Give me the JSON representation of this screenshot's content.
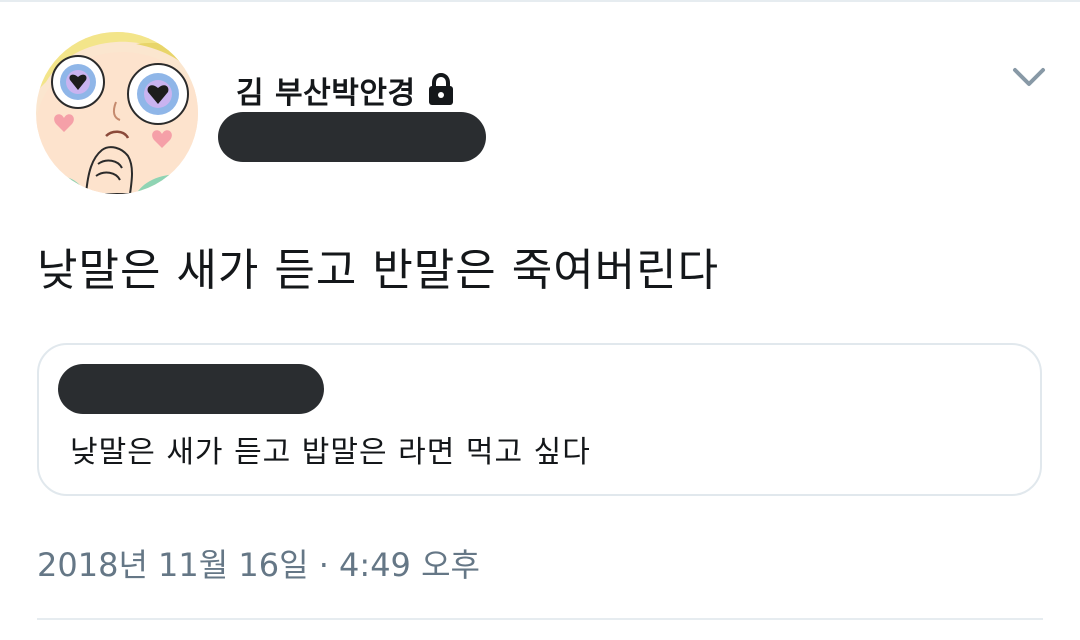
{
  "tweet": {
    "author": {
      "display_name": "김 부산박안경",
      "protected_icon": "lock-icon",
      "avatar_icon": "cartoon-avatar"
    },
    "menu_icon": "chevron-down-icon",
    "text": "낮말은 새가 듣고 반말은 죽여버린다",
    "quoted_tweet": {
      "text": "낮말은 새가 듣고 밥말은 라면 먹고 싶다"
    },
    "timestamp": "2018년 11월 16일 · 4:49 오후"
  },
  "colors": {
    "text_primary": "#14171a",
    "text_secondary": "#657786",
    "border": "#e1e8ed",
    "redaction": "#2a2d30"
  }
}
